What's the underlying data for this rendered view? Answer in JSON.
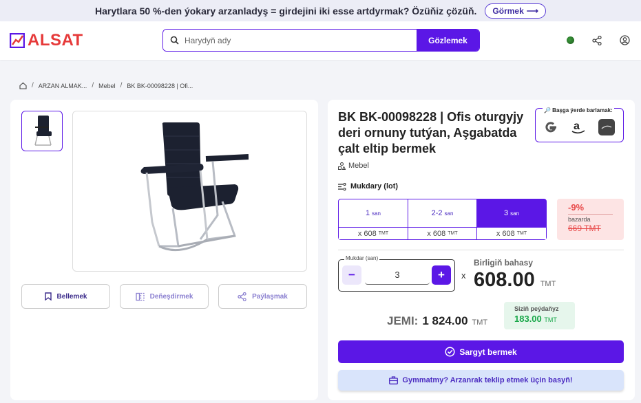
{
  "banner": {
    "text": "Harytlara 50 %-den ýokary arzanladyş = girdejini iki esse artdyrmak? Özüňiz çözüň.",
    "button": "Görmek"
  },
  "header": {
    "logo": "ALSAT",
    "search_placeholder": "Harydyň ady",
    "search_button": "Gözlemek"
  },
  "breadcrumb": [
    "ARZAN ALMAK...",
    "Mebel",
    "BK BK-00098228 | Ofi..."
  ],
  "product": {
    "title": "BK BK-00098228 | Ofis oturgyjy deri ornuny tutýan, Aşgabatda çalt eltip bermek",
    "category": "Mebel",
    "compare_label": "🔎 Başga ýerde barlamak:",
    "compare_icons": [
      "google-icon",
      "amazon-icon",
      "alibaba-icon"
    ]
  },
  "actions": {
    "save": "Bellemek",
    "compare": "Deňeşdirmek",
    "share": "Paýlaşmak"
  },
  "quantity": {
    "header": "Mukdary (lot)",
    "options": [
      {
        "qty": "1",
        "unit": "san",
        "price": "x 608",
        "currency": "TMT",
        "selected": false
      },
      {
        "qty": "2-2",
        "unit": "san",
        "price": "x 608",
        "currency": "TMT",
        "selected": false
      },
      {
        "qty": "3",
        "unit": "san",
        "price": "x 608",
        "currency": "TMT",
        "selected": true
      }
    ],
    "discount": {
      "percent": "-9%",
      "label": "bazarda",
      "old_price": "669 TMT"
    },
    "stepper_label": "Mukdar (san)",
    "stepper_value": "3"
  },
  "pricing": {
    "unit_label": "Birligiň bahasy",
    "unit_price": "608.00",
    "currency": "TMT",
    "times": "x",
    "total_label": "JEMI:",
    "total": "1 824.00",
    "savings_label": "Siziň peýdaňyz",
    "savings": "183.00"
  },
  "buttons": {
    "order": "Sargyt bermek",
    "offer": "Gymmatmy? Arzanrak teklip etmek üçin basyň!"
  },
  "colors": {
    "primary": "#5b17e6",
    "discount": "#e84a4a",
    "savings": "#1aa84a"
  }
}
